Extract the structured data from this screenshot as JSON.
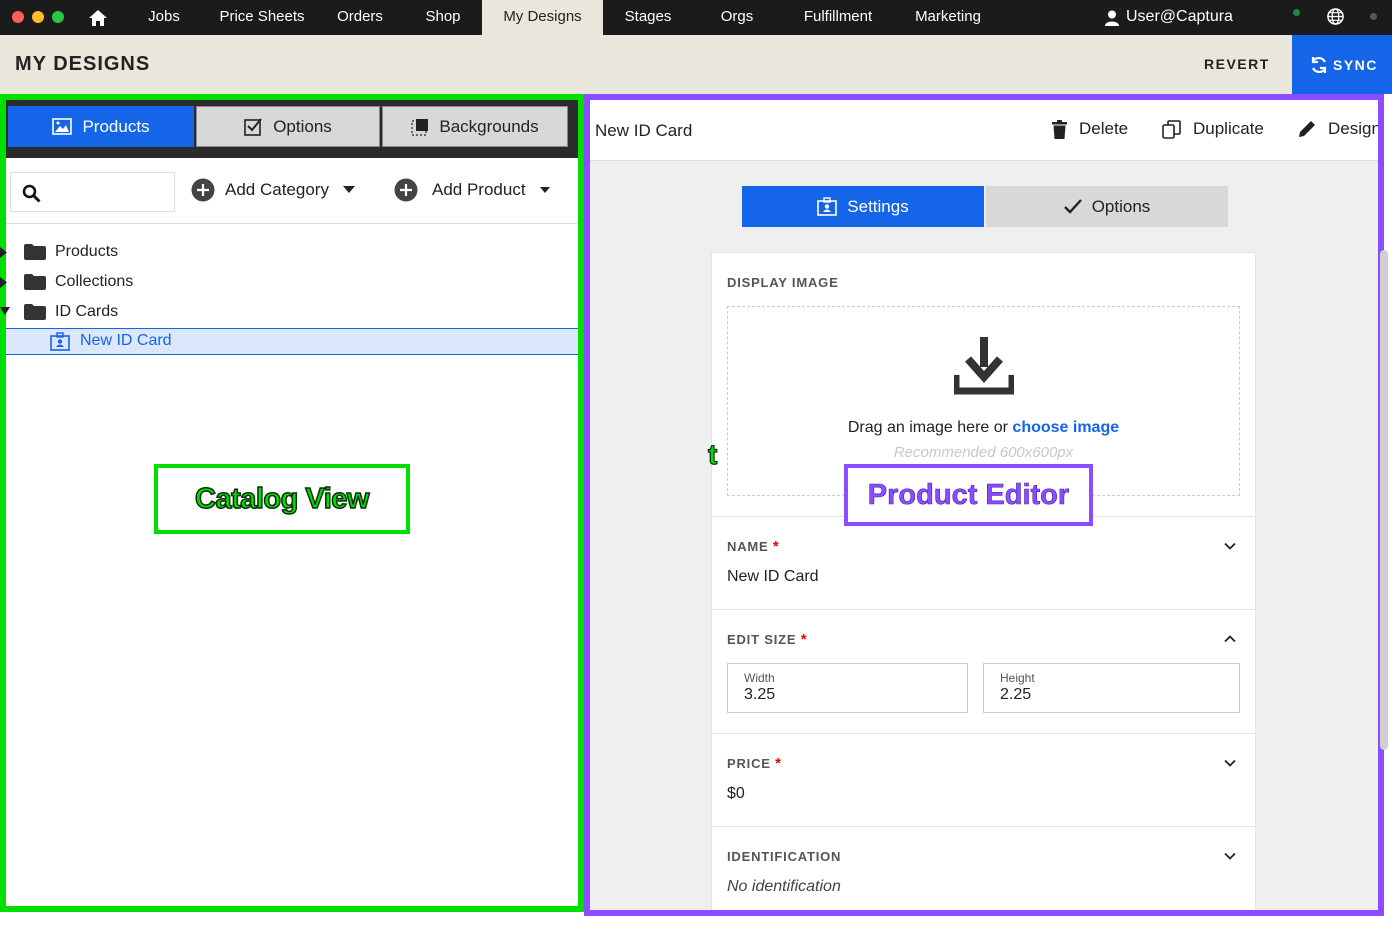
{
  "nav": {
    "items": [
      "Jobs",
      "Price Sheets",
      "Orders",
      "Shop",
      "My Designs",
      "Stages",
      "Orgs",
      "Fulfillment",
      "Marketing"
    ],
    "active": "My Designs",
    "user": "User@Captura"
  },
  "header": {
    "title": "MY DESIGNS",
    "revert_label": "REVERT",
    "sync_label": "SYNC"
  },
  "catalog": {
    "tabs": [
      "Products",
      "Options",
      "Backgrounds"
    ],
    "active_tab": "Products",
    "add_category_label": "Add Category",
    "add_product_label": "Add Product",
    "tree": [
      {
        "label": "Products",
        "type": "folder",
        "expanded": false
      },
      {
        "label": "Collections",
        "type": "folder",
        "expanded": false
      },
      {
        "label": "ID Cards",
        "type": "folder",
        "expanded": true
      },
      {
        "label": "New ID Card",
        "type": "product",
        "selected": true
      }
    ]
  },
  "annotations": {
    "catalog_label": "Catalog View",
    "editor_label": "Product Editor",
    "stray_char": "t"
  },
  "editor": {
    "product_name": "New ID Card",
    "delete_label": "Delete",
    "duplicate_label": "Duplicate",
    "design_label": "Design",
    "tabs": [
      "Settings",
      "Options"
    ],
    "active_tab": "Settings",
    "display_image": {
      "label": "DISPLAY IMAGE",
      "drag_text": "Drag an image here or",
      "choose_link": "choose image",
      "recommended": "Recommended 600x600px"
    },
    "name": {
      "label": "NAME",
      "value": "New ID Card"
    },
    "edit_size": {
      "label": "EDIT SIZE",
      "width_label": "Width",
      "width_value": "3.25",
      "height_label": "Height",
      "height_value": "2.25"
    },
    "price": {
      "label": "PRICE",
      "value": "$0"
    },
    "identification": {
      "label": "IDENTIFICATION",
      "value": "No identification"
    }
  },
  "colors": {
    "accent": "#1565e8",
    "catalog_highlight": "#00e000",
    "editor_highlight": "#8a4dff",
    "required": "#ee0000"
  }
}
